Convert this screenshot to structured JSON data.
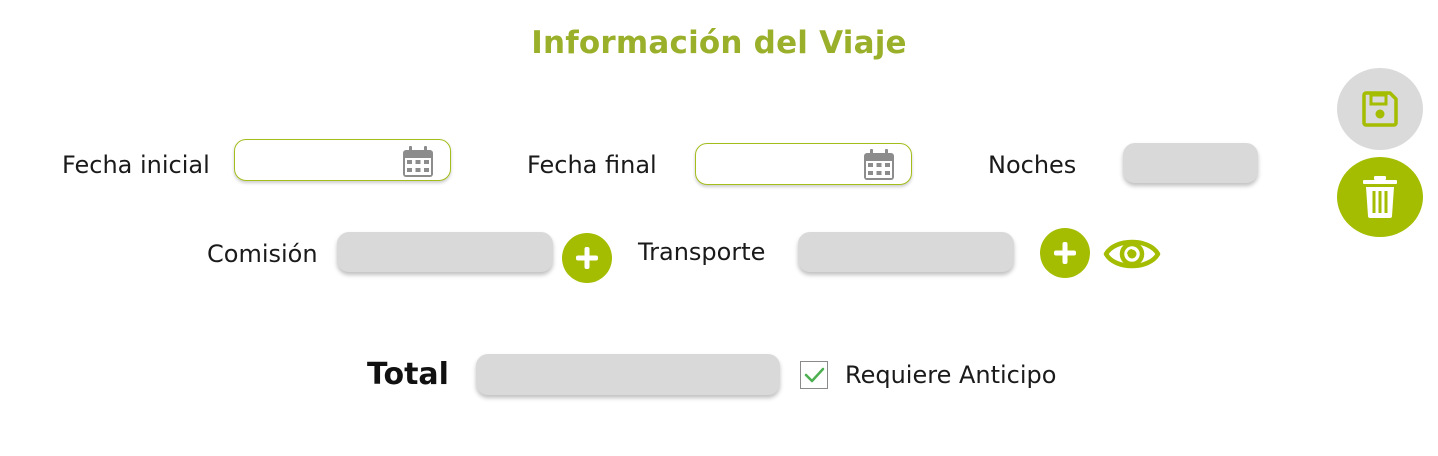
{
  "header": {
    "title": "Información del Viaje"
  },
  "form": {
    "fecha_inicial": {
      "label": "Fecha inicial",
      "value": ""
    },
    "fecha_final": {
      "label": "Fecha final",
      "value": ""
    },
    "noches": {
      "label": "Noches",
      "value": ""
    },
    "comision": {
      "label": "Comisión",
      "value": ""
    },
    "transporte": {
      "label": "Transporte",
      "value": ""
    },
    "total": {
      "label": "Total",
      "value": ""
    },
    "requiere_anticipo": {
      "label": "Requiere Anticipo",
      "checked": true
    }
  },
  "icons": {
    "calendar": "calendar-icon",
    "plus": "plus-icon",
    "eye": "eye-icon",
    "save": "save-icon",
    "trash": "trash-icon",
    "check": "check-icon"
  },
  "colors": {
    "accent": "#a4bd00",
    "title": "#9aaf2a",
    "field_grey": "#d9d9d9",
    "fab_grey": "#dadada",
    "icon_grey": "#8c8c8c"
  }
}
